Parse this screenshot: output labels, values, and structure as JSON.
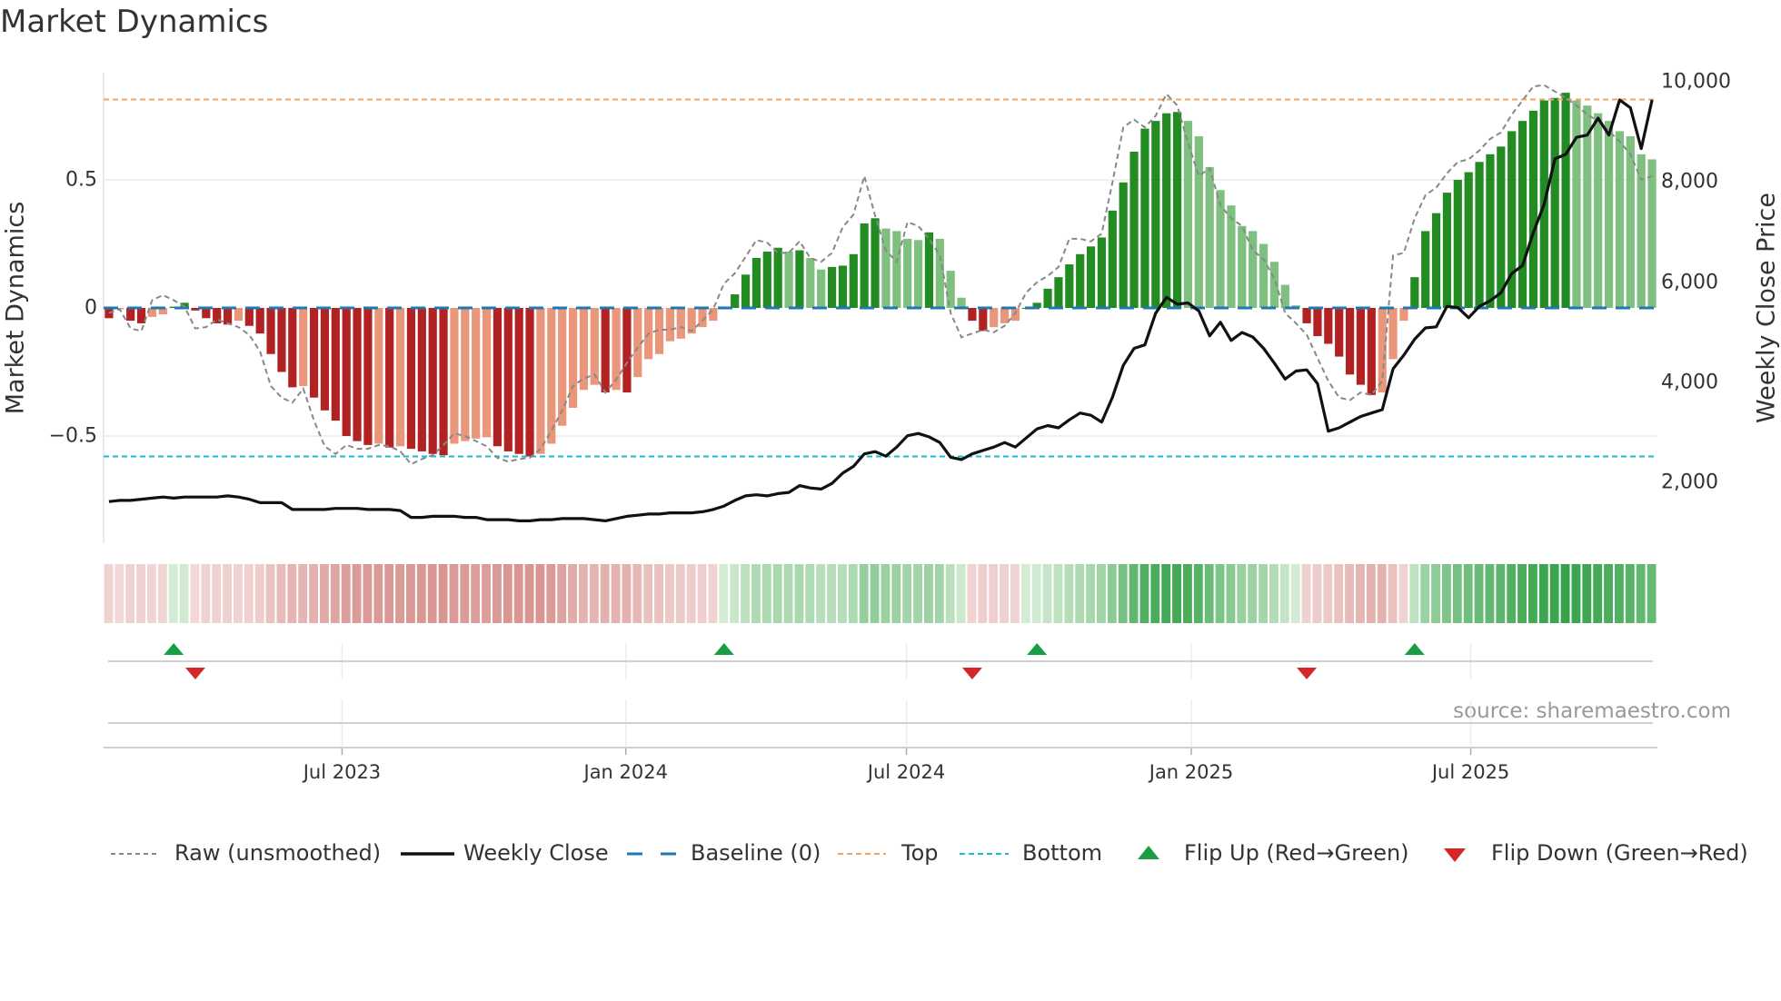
{
  "chart_data": {
    "type": "bar",
    "title": "Market Dynamics",
    "ylabel": "Market Dynamics",
    "y2label": "Weekly Close Price",
    "ylim": [
      -0.85,
      0.92
    ],
    "y2lim": [
      0,
      10500
    ],
    "left_ticks": [
      {
        "v": 0.5,
        "label": "0.5"
      },
      {
        "v": 0,
        "label": "0"
      },
      {
        "v": -0.5,
        "label": "−0.5"
      }
    ],
    "right_ticks": [
      {
        "v": 10000,
        "label": "10,000"
      },
      {
        "v": 8000,
        "label": "8,000"
      },
      {
        "v": 6000,
        "label": "6,000"
      },
      {
        "v": 4000,
        "label": "4,000"
      },
      {
        "v": 2000,
        "label": "2,000"
      }
    ],
    "x_ticks": [
      {
        "week": 21.6,
        "label": "Jul 2023"
      },
      {
        "week": 47.9,
        "label": "Jan 2024"
      },
      {
        "week": 73.9,
        "label": "Jul 2024"
      },
      {
        "week": 100.3,
        "label": "Jan 2025"
      },
      {
        "week": 126.2,
        "label": "Jul 2025"
      }
    ],
    "top_level": 0.814,
    "bottom_level": -0.58,
    "baseline": 0,
    "smoothed": [
      -0.04,
      -0.005,
      -0.05,
      -0.06,
      -0.035,
      -0.025,
      0.005,
      0.02,
      -0.01,
      -0.04,
      -0.06,
      -0.065,
      -0.05,
      -0.07,
      -0.1,
      -0.18,
      -0.25,
      -0.31,
      -0.305,
      -0.35,
      -0.4,
      -0.44,
      -0.5,
      -0.52,
      -0.535,
      -0.53,
      -0.545,
      -0.54,
      -0.55,
      -0.56,
      -0.57,
      -0.575,
      -0.53,
      -0.52,
      -0.51,
      -0.505,
      -0.54,
      -0.56,
      -0.57,
      -0.58,
      -0.57,
      -0.53,
      -0.46,
      -0.39,
      -0.32,
      -0.3,
      -0.33,
      -0.32,
      -0.33,
      -0.27,
      -0.2,
      -0.18,
      -0.13,
      -0.12,
      -0.1,
      -0.075,
      -0.05,
      0.0,
      0.053,
      0.13,
      0.195,
      0.22,
      0.235,
      0.22,
      0.225,
      0.195,
      0.15,
      0.16,
      0.165,
      0.21,
      0.33,
      0.35,
      0.31,
      0.3,
      0.27,
      0.265,
      0.295,
      0.27,
      0.145,
      0.04,
      -0.05,
      -0.09,
      -0.075,
      -0.06,
      -0.05,
      0.0,
      0.02,
      0.075,
      0.12,
      0.17,
      0.21,
      0.24,
      0.275,
      0.38,
      0.49,
      0.61,
      0.7,
      0.73,
      0.76,
      0.765,
      0.73,
      0.67,
      0.55,
      0.46,
      0.4,
      0.32,
      0.3,
      0.25,
      0.18,
      0.09,
      0.01,
      -0.06,
      -0.11,
      -0.14,
      -0.19,
      -0.26,
      -0.3,
      -0.34,
      -0.33,
      -0.2,
      -0.05,
      0.12,
      0.3,
      0.37,
      0.45,
      0.5,
      0.53,
      0.57,
      0.6,
      0.63,
      0.69,
      0.73,
      0.77,
      0.81,
      0.82,
      0.84,
      0.81,
      0.79,
      0.76,
      0.73,
      0.69,
      0.67,
      0.6,
      0.58
    ],
    "raw": [
      -0.02,
      -0.005,
      -0.08,
      -0.09,
      0.03,
      0.05,
      0.03,
      0.005,
      -0.08,
      -0.075,
      -0.045,
      -0.06,
      -0.075,
      -0.105,
      -0.17,
      -0.305,
      -0.35,
      -0.37,
      -0.315,
      -0.44,
      -0.54,
      -0.57,
      -0.535,
      -0.55,
      -0.55,
      -0.535,
      -0.54,
      -0.56,
      -0.61,
      -0.59,
      -0.575,
      -0.535,
      -0.49,
      -0.5,
      -0.52,
      -0.54,
      -0.585,
      -0.6,
      -0.59,
      -0.585,
      -0.55,
      -0.48,
      -0.4,
      -0.305,
      -0.275,
      -0.26,
      -0.33,
      -0.28,
      -0.215,
      -0.155,
      -0.1,
      -0.085,
      -0.085,
      -0.075,
      -0.09,
      -0.05,
      -0.005,
      0.095,
      0.135,
      0.2,
      0.265,
      0.255,
      0.215,
      0.215,
      0.26,
      0.195,
      0.18,
      0.215,
      0.315,
      0.365,
      0.515,
      0.36,
      0.225,
      0.18,
      0.335,
      0.32,
      0.27,
      0.205,
      -0.02,
      -0.115,
      -0.1,
      -0.085,
      -0.095,
      -0.07,
      -0.02,
      0.06,
      0.1,
      0.125,
      0.16,
      0.27,
      0.27,
      0.26,
      0.29,
      0.49,
      0.705,
      0.735,
      0.705,
      0.75,
      0.835,
      0.79,
      0.645,
      0.515,
      0.545,
      0.4,
      0.35,
      0.32,
      0.225,
      0.19,
      0.115,
      -0.02,
      -0.06,
      -0.105,
      -0.195,
      -0.285,
      -0.35,
      -0.36,
      -0.33,
      -0.34,
      -0.285,
      0.205,
      0.215,
      0.35,
      0.44,
      0.47,
      0.525,
      0.57,
      0.58,
      0.615,
      0.66,
      0.685,
      0.755,
      0.81,
      0.865,
      0.87,
      0.845,
      0.82,
      0.79,
      0.755,
      0.73,
      0.69,
      0.65,
      0.6,
      0.5,
      0.515
    ],
    "close": [
      1616,
      1639,
      1639,
      1662,
      1684,
      1707,
      1684,
      1707,
      1707,
      1707,
      1707,
      1730,
      1707,
      1662,
      1594,
      1594,
      1594,
      1458,
      1458,
      1458,
      1458,
      1480,
      1480,
      1480,
      1458,
      1458,
      1458,
      1435,
      1299,
      1299,
      1322,
      1322,
      1322,
      1299,
      1299,
      1254,
      1254,
      1254,
      1231,
      1231,
      1254,
      1254,
      1276,
      1276,
      1276,
      1254,
      1231,
      1276,
      1322,
      1344,
      1367,
      1367,
      1390,
      1390,
      1390,
      1412,
      1458,
      1526,
      1639,
      1730,
      1752,
      1730,
      1775,
      1798,
      1934,
      1888,
      1866,
      1979,
      2183,
      2319,
      2568,
      2613,
      2523,
      2704,
      2931,
      2976,
      2908,
      2795,
      2500,
      2455,
      2568,
      2636,
      2704,
      2795,
      2704,
      2885,
      3066,
      3134,
      3089,
      3248,
      3384,
      3338,
      3202,
      3701,
      4336,
      4675,
      4744,
      5378,
      5695,
      5559,
      5582,
      5423,
      4925,
      5197,
      4834,
      4993,
      4902,
      4675,
      4381,
      4063,
      4222,
      4245,
      3973,
      3021,
      3089,
      3202,
      3316,
      3384,
      3452,
      4268,
      4540,
      4857,
      5083,
      5106,
      5514,
      5491,
      5287,
      5514,
      5627,
      5786,
      6171,
      6330,
      6987,
      7553,
      8460,
      8550,
      8890,
      8935,
      9275,
      8935,
      9638,
      9479,
      8664,
      9638
    ],
    "flip_up_weeks": [
      6,
      57,
      86,
      121
    ],
    "flip_down_weeks": [
      8,
      80,
      111
    ],
    "colors": {
      "strong_up": "#228b22",
      "weak_up": "#7fbf7f",
      "strong_down": "#b22222",
      "weak_down": "#e9967a",
      "close": "#111111",
      "raw": "#888888",
      "baseline": "#1f77b4",
      "top": "#f4a460",
      "bottom": "#17becf",
      "flip_up": "#1a9e45",
      "flip_down": "#d62728"
    },
    "legend": [
      {
        "key": "raw",
        "label": "Raw (unsmoothed)"
      },
      {
        "key": "close",
        "label": "Weekly Close"
      },
      {
        "key": "baseline",
        "label": "Baseline (0)"
      },
      {
        "key": "top",
        "label": "Top"
      },
      {
        "key": "bottom",
        "label": "Bottom"
      },
      {
        "key": "flip_up",
        "label": "Flip Up (Red→Green)"
      },
      {
        "key": "flip_down",
        "label": "Flip Down (Green→Red)"
      }
    ],
    "legend_placement": "bottom",
    "source": "source: sharemaestro.com"
  }
}
